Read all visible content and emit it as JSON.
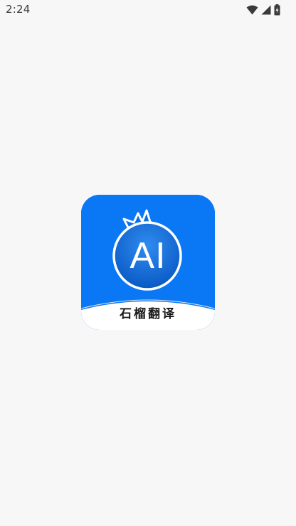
{
  "status_bar": {
    "time": "2:24",
    "icons": [
      "wifi-icon",
      "cellular-signal-icon",
      "battery-icon"
    ]
  },
  "splash": {
    "logo_text": "AI",
    "app_name": "石榴翻译",
    "brand_color": "#0a78f5",
    "background_color": "#f7f7f7"
  }
}
